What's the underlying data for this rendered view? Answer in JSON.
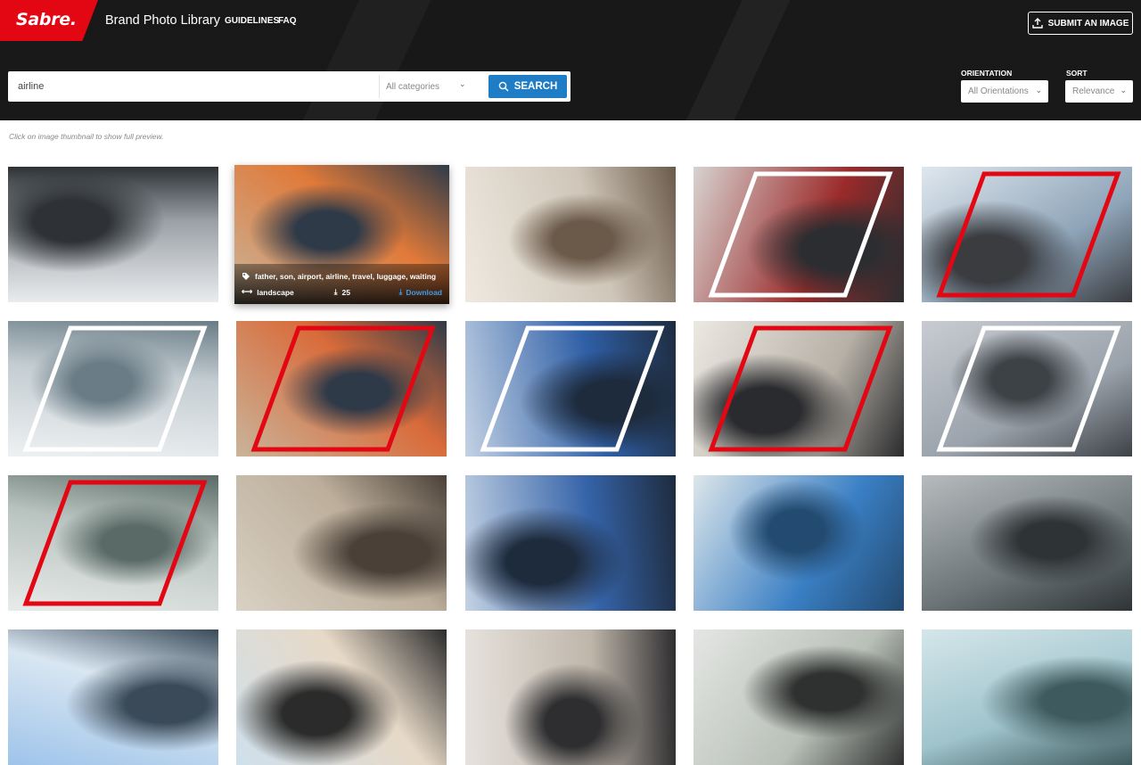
{
  "header": {
    "logo_text": "Sabre.",
    "title": "Brand Photo Library",
    "nav": [
      "GUIDELINES",
      "FAQ"
    ],
    "submit_label": "SUBMIT AN IMAGE",
    "brand_color": "#e30613"
  },
  "search": {
    "value": "airline",
    "category": "All categories",
    "button_label": "SEARCH",
    "button_color": "#1f7dc5"
  },
  "filters": {
    "orientation_label": "ORIENTATION",
    "orientation_value": "All Orientations",
    "sort_label": "SORT",
    "sort_value": "Relevance"
  },
  "hint": "Click on image thumbnail to show full preview.",
  "hover_card": {
    "tags": "father, son, airport, airline, travel, luggage, waiting",
    "orientation": "landscape",
    "downloads": "25",
    "download_label": "Download"
  },
  "images": [
    {
      "name": "jet-engine-landing-gear",
      "colors": [
        "#e9ebed",
        "#9aa0a6",
        "#2e3236"
      ]
    },
    {
      "name": "father-son-pointing",
      "colors": [
        "#c9b49a",
        "#e07a3a",
        "#2f3a48"
      ]
    },
    {
      "name": "airplane-cabin",
      "colors": [
        "#efe9e0",
        "#cfc6b9",
        "#6b5a4a"
      ]
    },
    {
      "name": "baggage-handlers",
      "colors": [
        "#d7d3d0",
        "#9b2a2a",
        "#2b2d30"
      ]
    },
    {
      "name": "business-handshake",
      "colors": [
        "#dfe7ee",
        "#8ea4b8",
        "#3a3c40"
      ]
    },
    {
      "name": "woman-laptop-phone",
      "colors": [
        "#eef1f2",
        "#c4cdd2",
        "#6a7c86"
      ]
    },
    {
      "name": "father-son-pointing-frame",
      "colors": [
        "#c9b49a",
        "#d96b3a",
        "#2f3a48"
      ]
    },
    {
      "name": "woman-departure-board",
      "colors": [
        "#c3d2e4",
        "#2f5fa6",
        "#1e2b3d"
      ]
    },
    {
      "name": "passport-check-in",
      "colors": [
        "#ece8e2",
        "#b6b0a6",
        "#2a2b2e"
      ]
    },
    {
      "name": "jet-engine-frame",
      "colors": [
        "#c8ccd2",
        "#9aa2ab",
        "#3d4246"
      ]
    },
    {
      "name": "woman-walkway-luggage",
      "colors": [
        "#e8ebea",
        "#b8c3bf",
        "#5a6a66"
      ]
    },
    {
      "name": "woman-seated-suitcase",
      "colors": [
        "#d9d1c4",
        "#bcae9a",
        "#4a4038"
      ]
    },
    {
      "name": "woman-departure-board-2",
      "colors": [
        "#c3d2e4",
        "#3563a8",
        "#1e2b3d"
      ]
    },
    {
      "name": "kids-on-moving-walkway",
      "colors": [
        "#dde6ea",
        "#3a7fc4",
        "#234a70"
      ]
    },
    {
      "name": "woman-terminal-hall",
      "colors": [
        "#b6bcbe",
        "#6d7578",
        "#2e3436"
      ]
    },
    {
      "name": "plane-front-view",
      "colors": [
        "#9ec4ea",
        "#d9e6f2",
        "#3a4a58"
      ]
    },
    {
      "name": "plane-takeoff",
      "colors": [
        "#cfe0ec",
        "#e7d9c7",
        "#2b2b2b"
      ]
    },
    {
      "name": "business-travelers",
      "colors": [
        "#e6e2dd",
        "#bfb6aa",
        "#2e2e30"
      ]
    },
    {
      "name": "businessman-phone",
      "colors": [
        "#e4e6e3",
        "#b9c0b8",
        "#2f3130"
      ]
    },
    {
      "name": "airport-hall-woman",
      "colors": [
        "#d4e6ea",
        "#9fc4cc",
        "#3f5a5e"
      ]
    }
  ]
}
